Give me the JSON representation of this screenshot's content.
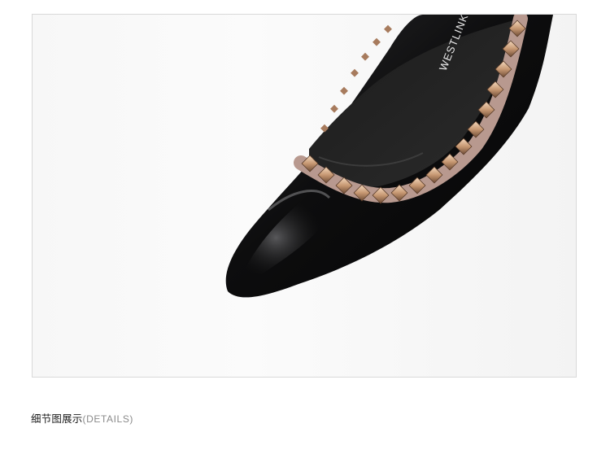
{
  "photo": {
    "subject": "black patent pointed-toe flat shoe with rose-gold rivet trim",
    "brand_text": "WESTLINK",
    "colors": {
      "leather": "#0b0b0c",
      "trim": "#b8998f",
      "rivet": "#c9a07c",
      "background": "#f5f5f5"
    }
  },
  "caption": {
    "title_cn": "细节图展示",
    "title_en": "(DETAILS)"
  }
}
